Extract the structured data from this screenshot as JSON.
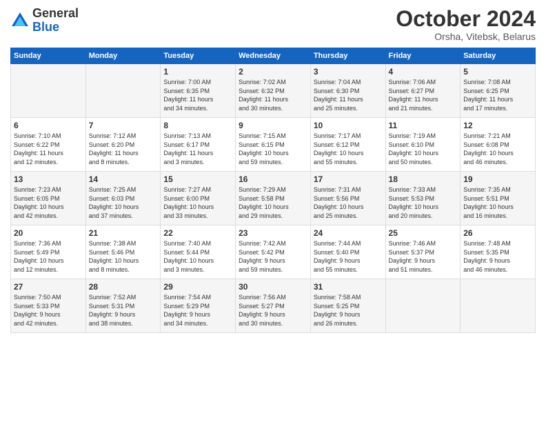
{
  "logo": {
    "line1": "General",
    "line2": "Blue"
  },
  "title": "October 2024",
  "subtitle": "Orsha, Vitebsk, Belarus",
  "weekdays": [
    "Sunday",
    "Monday",
    "Tuesday",
    "Wednesday",
    "Thursday",
    "Friday",
    "Saturday"
  ],
  "weeks": [
    [
      {
        "day": "",
        "info": ""
      },
      {
        "day": "",
        "info": ""
      },
      {
        "day": "1",
        "info": "Sunrise: 7:00 AM\nSunset: 6:35 PM\nDaylight: 11 hours\nand 34 minutes."
      },
      {
        "day": "2",
        "info": "Sunrise: 7:02 AM\nSunset: 6:32 PM\nDaylight: 11 hours\nand 30 minutes."
      },
      {
        "day": "3",
        "info": "Sunrise: 7:04 AM\nSunset: 6:30 PM\nDaylight: 11 hours\nand 25 minutes."
      },
      {
        "day": "4",
        "info": "Sunrise: 7:06 AM\nSunset: 6:27 PM\nDaylight: 11 hours\nand 21 minutes."
      },
      {
        "day": "5",
        "info": "Sunrise: 7:08 AM\nSunset: 6:25 PM\nDaylight: 11 hours\nand 17 minutes."
      }
    ],
    [
      {
        "day": "6",
        "info": "Sunrise: 7:10 AM\nSunset: 6:22 PM\nDaylight: 11 hours\nand 12 minutes."
      },
      {
        "day": "7",
        "info": "Sunrise: 7:12 AM\nSunset: 6:20 PM\nDaylight: 11 hours\nand 8 minutes."
      },
      {
        "day": "8",
        "info": "Sunrise: 7:13 AM\nSunset: 6:17 PM\nDaylight: 11 hours\nand 3 minutes."
      },
      {
        "day": "9",
        "info": "Sunrise: 7:15 AM\nSunset: 6:15 PM\nDaylight: 10 hours\nand 59 minutes."
      },
      {
        "day": "10",
        "info": "Sunrise: 7:17 AM\nSunset: 6:12 PM\nDaylight: 10 hours\nand 55 minutes."
      },
      {
        "day": "11",
        "info": "Sunrise: 7:19 AM\nSunset: 6:10 PM\nDaylight: 10 hours\nand 50 minutes."
      },
      {
        "day": "12",
        "info": "Sunrise: 7:21 AM\nSunset: 6:08 PM\nDaylight: 10 hours\nand 46 minutes."
      }
    ],
    [
      {
        "day": "13",
        "info": "Sunrise: 7:23 AM\nSunset: 6:05 PM\nDaylight: 10 hours\nand 42 minutes."
      },
      {
        "day": "14",
        "info": "Sunrise: 7:25 AM\nSunset: 6:03 PM\nDaylight: 10 hours\nand 37 minutes."
      },
      {
        "day": "15",
        "info": "Sunrise: 7:27 AM\nSunset: 6:00 PM\nDaylight: 10 hours\nand 33 minutes."
      },
      {
        "day": "16",
        "info": "Sunrise: 7:29 AM\nSunset: 5:58 PM\nDaylight: 10 hours\nand 29 minutes."
      },
      {
        "day": "17",
        "info": "Sunrise: 7:31 AM\nSunset: 5:56 PM\nDaylight: 10 hours\nand 25 minutes."
      },
      {
        "day": "18",
        "info": "Sunrise: 7:33 AM\nSunset: 5:53 PM\nDaylight: 10 hours\nand 20 minutes."
      },
      {
        "day": "19",
        "info": "Sunrise: 7:35 AM\nSunset: 5:51 PM\nDaylight: 10 hours\nand 16 minutes."
      }
    ],
    [
      {
        "day": "20",
        "info": "Sunrise: 7:36 AM\nSunset: 5:49 PM\nDaylight: 10 hours\nand 12 minutes."
      },
      {
        "day": "21",
        "info": "Sunrise: 7:38 AM\nSunset: 5:46 PM\nDaylight: 10 hours\nand 8 minutes."
      },
      {
        "day": "22",
        "info": "Sunrise: 7:40 AM\nSunset: 5:44 PM\nDaylight: 10 hours\nand 3 minutes."
      },
      {
        "day": "23",
        "info": "Sunrise: 7:42 AM\nSunset: 5:42 PM\nDaylight: 9 hours\nand 59 minutes."
      },
      {
        "day": "24",
        "info": "Sunrise: 7:44 AM\nSunset: 5:40 PM\nDaylight: 9 hours\nand 55 minutes."
      },
      {
        "day": "25",
        "info": "Sunrise: 7:46 AM\nSunset: 5:37 PM\nDaylight: 9 hours\nand 51 minutes."
      },
      {
        "day": "26",
        "info": "Sunrise: 7:48 AM\nSunset: 5:35 PM\nDaylight: 9 hours\nand 46 minutes."
      }
    ],
    [
      {
        "day": "27",
        "info": "Sunrise: 7:50 AM\nSunset: 5:33 PM\nDaylight: 9 hours\nand 42 minutes."
      },
      {
        "day": "28",
        "info": "Sunrise: 7:52 AM\nSunset: 5:31 PM\nDaylight: 9 hours\nand 38 minutes."
      },
      {
        "day": "29",
        "info": "Sunrise: 7:54 AM\nSunset: 5:29 PM\nDaylight: 9 hours\nand 34 minutes."
      },
      {
        "day": "30",
        "info": "Sunrise: 7:56 AM\nSunset: 5:27 PM\nDaylight: 9 hours\nand 30 minutes."
      },
      {
        "day": "31",
        "info": "Sunrise: 7:58 AM\nSunset: 5:25 PM\nDaylight: 9 hours\nand 26 minutes."
      },
      {
        "day": "",
        "info": ""
      },
      {
        "day": "",
        "info": ""
      }
    ]
  ]
}
